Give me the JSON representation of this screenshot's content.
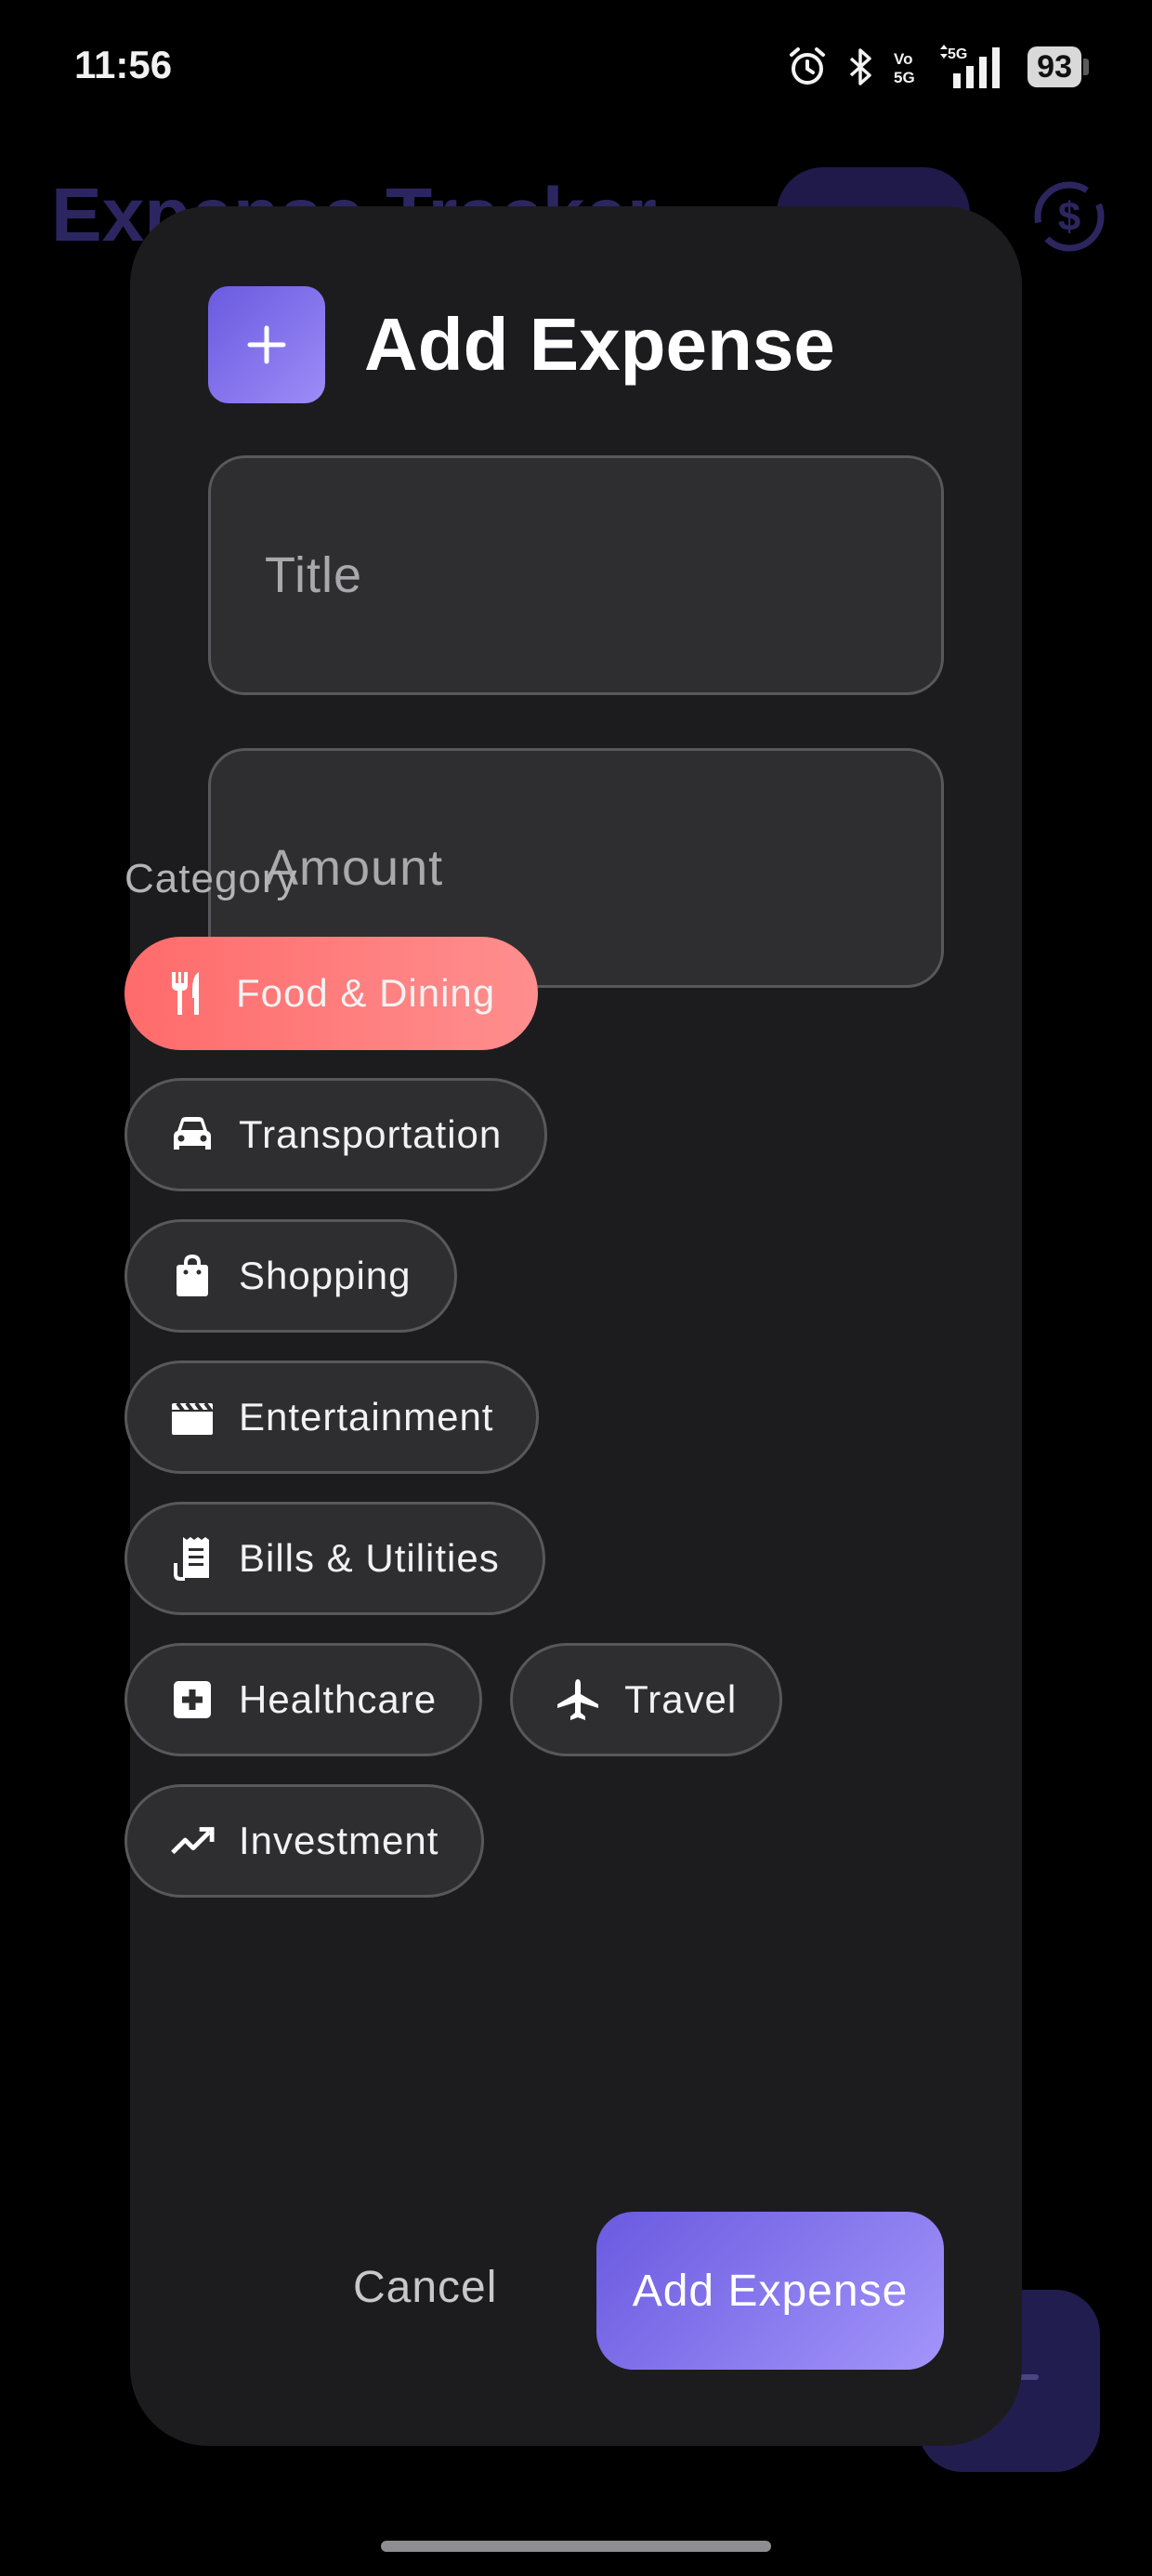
{
  "status_bar": {
    "time": "11:56",
    "battery": "93",
    "network": "5G",
    "icons": [
      "alarm-icon",
      "bluetooth-icon",
      "volte-icon",
      "signal-icon",
      "battery-icon"
    ]
  },
  "background": {
    "app_title": "Expense Tracker",
    "colors": {
      "title": "#2c2660",
      "fab": "#221d4f"
    }
  },
  "dialog": {
    "title": "Add Expense",
    "header_icon": "plus-icon",
    "fields": {
      "title": {
        "value": "",
        "placeholder": "Title"
      },
      "amount": {
        "value": "",
        "placeholder": "Amount"
      }
    },
    "category_label": "Category",
    "categories": [
      {
        "label": "Food & Dining",
        "icon": "restaurant-icon",
        "selected": true
      },
      {
        "label": "Transportation",
        "icon": "car-icon",
        "selected": false
      },
      {
        "label": "Shopping",
        "icon": "shopping-bag-icon",
        "selected": false
      },
      {
        "label": "Entertainment",
        "icon": "movie-icon",
        "selected": false
      },
      {
        "label": "Bills & Utilities",
        "icon": "receipt-icon",
        "selected": false
      },
      {
        "label": "Healthcare",
        "icon": "medical-icon",
        "selected": false
      },
      {
        "label": "Travel",
        "icon": "airplane-icon",
        "selected": false
      },
      {
        "label": "Investment",
        "icon": "trending-up-icon",
        "selected": false
      }
    ],
    "cancel_label": "Cancel",
    "submit_label": "Add Expense",
    "colors": {
      "accent": "#6a5ae0",
      "selected_chip": "#ff6b6b",
      "surface": "#1c1c1e"
    }
  }
}
